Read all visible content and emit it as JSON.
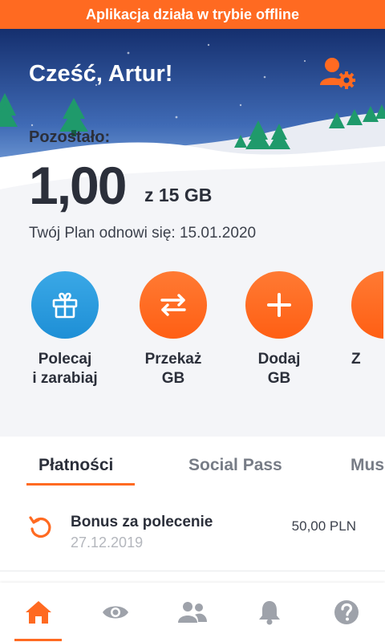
{
  "offline_banner": "Aplikacja działa w trybie offline",
  "header": {
    "greeting": "Cześć, Artur!",
    "profile_icon": "user-settings-icon"
  },
  "usage": {
    "remaining_label": "Pozostało:",
    "amount": "1,00",
    "total": "z 15 GB",
    "renewal": "Twój Plan odnowi się: 15.01.2020"
  },
  "actions": [
    {
      "label_line1": "Polecaj",
      "label_line2": "i zarabiaj",
      "icon": "gift-icon",
      "color": "#2d9fe0"
    },
    {
      "label_line1": "Przekaż",
      "label_line2": "GB",
      "icon": "transfer-arrows-icon",
      "color": "#ff6a21"
    },
    {
      "label_line1": "Dodaj",
      "label_line2": "GB",
      "icon": "plus-icon",
      "color": "#ff6a21"
    },
    {
      "label_line1": "Z",
      "label_line2": "",
      "icon": "",
      "color": "#ff6a21"
    }
  ],
  "tabs": [
    {
      "label": "Płatności",
      "active": true
    },
    {
      "label": "Social Pass",
      "active": false
    },
    {
      "label": "Mus",
      "active": false
    }
  ],
  "transactions": [
    {
      "title": "Bonus za polecenie",
      "date": "27.12.2019",
      "amount": "50,00 PLN",
      "icon": "refund-arrow-icon"
    }
  ],
  "bottom_nav": [
    {
      "name": "home",
      "icon": "home-icon",
      "active": true
    },
    {
      "name": "preview",
      "icon": "eye-icon",
      "active": false
    },
    {
      "name": "friends",
      "icon": "users-icon",
      "active": false
    },
    {
      "name": "notifications",
      "icon": "bell-icon",
      "active": false
    },
    {
      "name": "help",
      "icon": "help-icon",
      "active": false
    }
  ],
  "colors": {
    "accent": "#ff6a21",
    "blue": "#2d9fe0",
    "sky_top": "#152f6e",
    "text": "#2b2f3a"
  }
}
